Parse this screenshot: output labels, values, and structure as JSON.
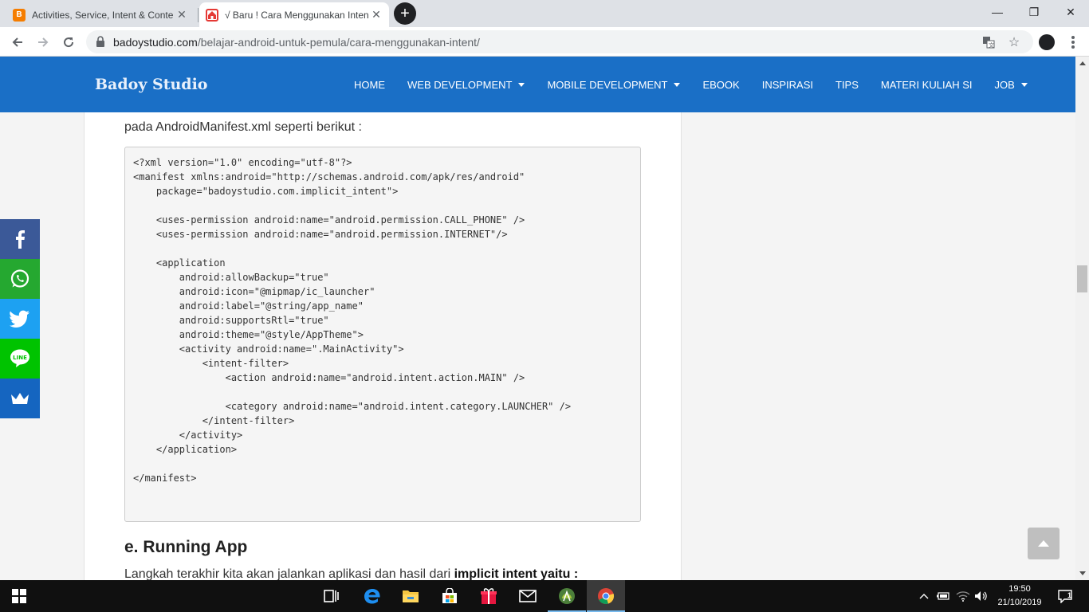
{
  "browser": {
    "tabs": [
      {
        "title": "Activities, Service, Intent & Conte",
        "favicon": "blogger-icon",
        "favicon_color": "#f57d00",
        "active": false
      },
      {
        "title": "√ Baru ! Cara Menggunakan Inten",
        "favicon": "badoy-house-icon",
        "favicon_color": "#e53935",
        "active": true
      }
    ],
    "new_tab_label": "+",
    "window_controls": {
      "minimize": "—",
      "restore": "❐",
      "close": "✕"
    },
    "url": {
      "domain": "badoystudio.com",
      "path": "/belajar-android-untuk-pemula/cara-menggunakan-intent/"
    }
  },
  "site": {
    "brand": "Badoy Studio",
    "header_color": "#1a6fc6",
    "nav": [
      {
        "label": "HOME",
        "dropdown": false
      },
      {
        "label": "WEB DEVELOPMENT",
        "dropdown": true
      },
      {
        "label": "MOBILE DEVELOPMENT",
        "dropdown": true
      },
      {
        "label": "EBOOK",
        "dropdown": false
      },
      {
        "label": "INSPIRASI",
        "dropdown": false
      },
      {
        "label": "TIPS",
        "dropdown": false
      },
      {
        "label": "MATERI KULIAH SI",
        "dropdown": false
      },
      {
        "label": "JOB",
        "dropdown": true
      }
    ]
  },
  "article": {
    "para_top": "pada AndroidManifest.xml seperti berikut :",
    "code": "<?xml version=\"1.0\" encoding=\"utf-8\"?>\n<manifest xmlns:android=\"http://schemas.android.com/apk/res/android\"\n    package=\"badoystudio.com.implicit_intent\">\n\n    <uses-permission android:name=\"android.permission.CALL_PHONE\" />\n    <uses-permission android:name=\"android.permission.INTERNET\"/>\n\n    <application\n        android:allowBackup=\"true\"\n        android:icon=\"@mipmap/ic_launcher\"\n        android:label=\"@string/app_name\"\n        android:supportsRtl=\"true\"\n        android:theme=\"@style/AppTheme\">\n        <activity android:name=\".MainActivity\">\n            <intent-filter>\n                <action android:name=\"android.intent.action.MAIN\" />\n\n                <category android:name=\"android.intent.category.LAUNCHER\" />\n            </intent-filter>\n        </activity>\n    </application>\n\n</manifest>",
    "section_heading": "e. Running App",
    "para_bottom_plain": "Langkah terakhir kita akan jalankan aplikasi dan hasil dari ",
    "para_bottom_bold": "implicit intent yaitu :"
  },
  "share": [
    {
      "name": "facebook-share-button",
      "icon": "facebook-icon",
      "color": "#3b5998"
    },
    {
      "name": "whatsapp-share-button",
      "icon": "whatsapp-icon",
      "color": "#25a830"
    },
    {
      "name": "twitter-share-button",
      "icon": "twitter-icon",
      "color": "#1da1f2"
    },
    {
      "name": "line-share-button",
      "icon": "line-icon",
      "color": "#00c300"
    },
    {
      "name": "sumome-share-button",
      "icon": "crown-icon",
      "color": "#1565c0"
    }
  ],
  "taskbar": {
    "time": "19:50",
    "date": "21/10/2019",
    "notification_count": "1",
    "apps": [
      "task-view-icon",
      "edge-icon",
      "file-explorer-icon",
      "store-icon",
      "gift-icon",
      "mail-icon",
      "android-studio-icon",
      "chrome-icon"
    ]
  }
}
